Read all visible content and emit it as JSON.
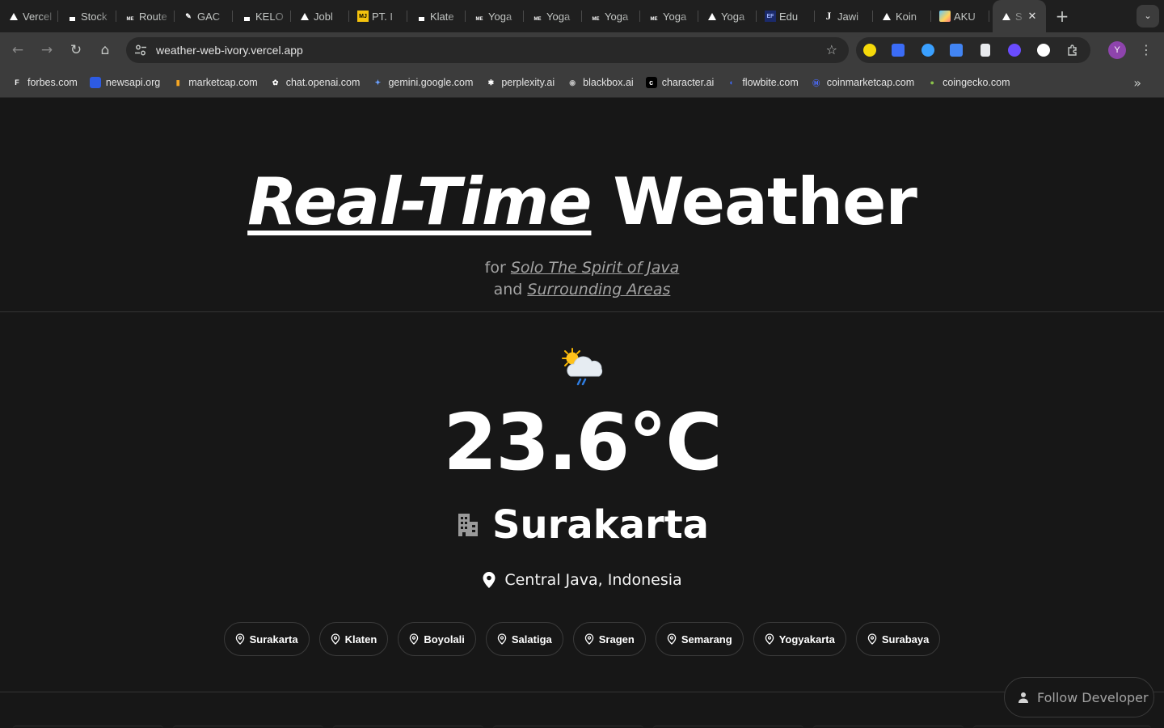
{
  "browser": {
    "tabs": [
      {
        "title": "Vercel",
        "favicon": "vercel-triangle"
      },
      {
        "title": "Stock",
        "favicon": "dot"
      },
      {
        "title": "Route",
        "favicon": "me"
      },
      {
        "title": "GAC",
        "favicon": "pen"
      },
      {
        "title": "KELO",
        "favicon": "dot"
      },
      {
        "title": "Jobl",
        "favicon": "vercel-triangle"
      },
      {
        "title": "PT. I",
        "favicon": "mj"
      },
      {
        "title": "Klate",
        "favicon": "dot"
      },
      {
        "title": "Yoga",
        "favicon": "me"
      },
      {
        "title": "Yoga",
        "favicon": "me"
      },
      {
        "title": "Yoga",
        "favicon": "me"
      },
      {
        "title": "Yoga",
        "favicon": "me"
      },
      {
        "title": "Yoga",
        "favicon": "vercel-triangle"
      },
      {
        "title": "Edu",
        "favicon": "ef"
      },
      {
        "title": "Jawi",
        "favicon": "j"
      },
      {
        "title": "Koin",
        "favicon": "vercel-triangle"
      },
      {
        "title": "AKU",
        "favicon": "picture"
      }
    ],
    "active_tab": {
      "title": "S",
      "close_glyph": "✕"
    },
    "new_tab_glyph": "+",
    "tab_search_glyph": "⌄",
    "url": "weather-web-ivory.vercel.app",
    "back_glyph": "←",
    "forward_glyph": "→",
    "reload_glyph": "↻",
    "home_glyph": "⌂",
    "bookmark_star_glyph": "☆",
    "profile_initial": "Y",
    "menu_glyph": "⋮",
    "bookmarks": [
      {
        "label": "forbes.com",
        "icon": "F",
        "color": "#3c3c3c",
        "fg": "#ffffff"
      },
      {
        "label": "newsapi.org",
        "icon": "",
        "color": "#2d5be3",
        "fg": "#ffffff"
      },
      {
        "label": "marketcap.com",
        "icon": "▮",
        "color": "#3c3c3c",
        "fg": "#f5a623"
      },
      {
        "label": "chat.openai.com",
        "icon": "✿",
        "color": "#3c3c3c",
        "fg": "#ffffff"
      },
      {
        "label": "gemini.google.com",
        "icon": "✦",
        "color": "#3c3c3c",
        "fg": "#6aa0ff"
      },
      {
        "label": "perplexity.ai",
        "icon": "✱",
        "color": "#3c3c3c",
        "fg": "#ffffff"
      },
      {
        "label": "blackbox.ai",
        "icon": "◉",
        "color": "#3c3c3c",
        "fg": "#bbbbbb"
      },
      {
        "label": "character.ai",
        "icon": "c",
        "color": "#000000",
        "fg": "#ffffff"
      },
      {
        "label": "flowbite.com",
        "icon": "◐",
        "color": "#3c3c3c",
        "fg": "#3f6bff"
      },
      {
        "label": "coinmarketcap.com",
        "icon": "Ⓜ",
        "color": "#3c3c3c",
        "fg": "#4b6bff"
      },
      {
        "label": "coingecko.com",
        "icon": "●",
        "color": "#3c3c3c",
        "fg": "#8bc34a"
      }
    ],
    "bookmarks_more_glyph": "»"
  },
  "hero": {
    "title_accent": "Real-Time",
    "title_rest": " Weather",
    "line1_prefix": "for ",
    "line1_link": "Solo The Spirit of Java",
    "line2_prefix": "and ",
    "line2_link": "Surrounding Areas"
  },
  "weather": {
    "icon": "sun-behind-rain-cloud-icon",
    "temperature": "23.6°C",
    "city": "Surakarta",
    "region": "Central Java, Indonesia"
  },
  "cities": [
    "Surakarta",
    "Klaten",
    "Boyolali",
    "Salatiga",
    "Sragen",
    "Semarang",
    "Yogyakarta",
    "Surabaya"
  ],
  "follow_button": "Follow Developer",
  "colors": {
    "background": "#171717",
    "text": "#ffffff",
    "muted": "#a3a3a3",
    "border": "#3a3a3a"
  }
}
